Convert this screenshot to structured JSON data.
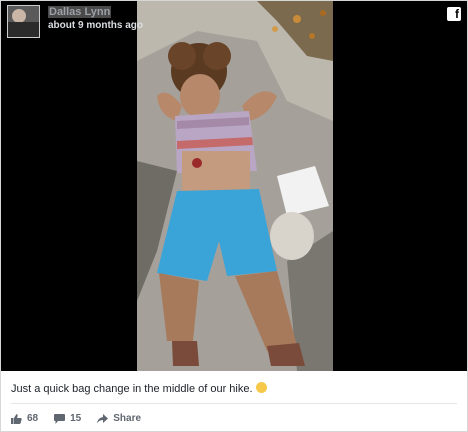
{
  "post": {
    "author_name": "Dallas Lynn",
    "timestamp": "about 9 months ago",
    "caption": "Just a quick bag change in the middle of our hike.",
    "likes": "68",
    "comments": "15",
    "share_label": "Share",
    "platform_icon": "facebook-icon",
    "emoji": "laughing-emoji"
  },
  "colors": {
    "background": "#000000",
    "accent_blue": "#40a9e0"
  }
}
